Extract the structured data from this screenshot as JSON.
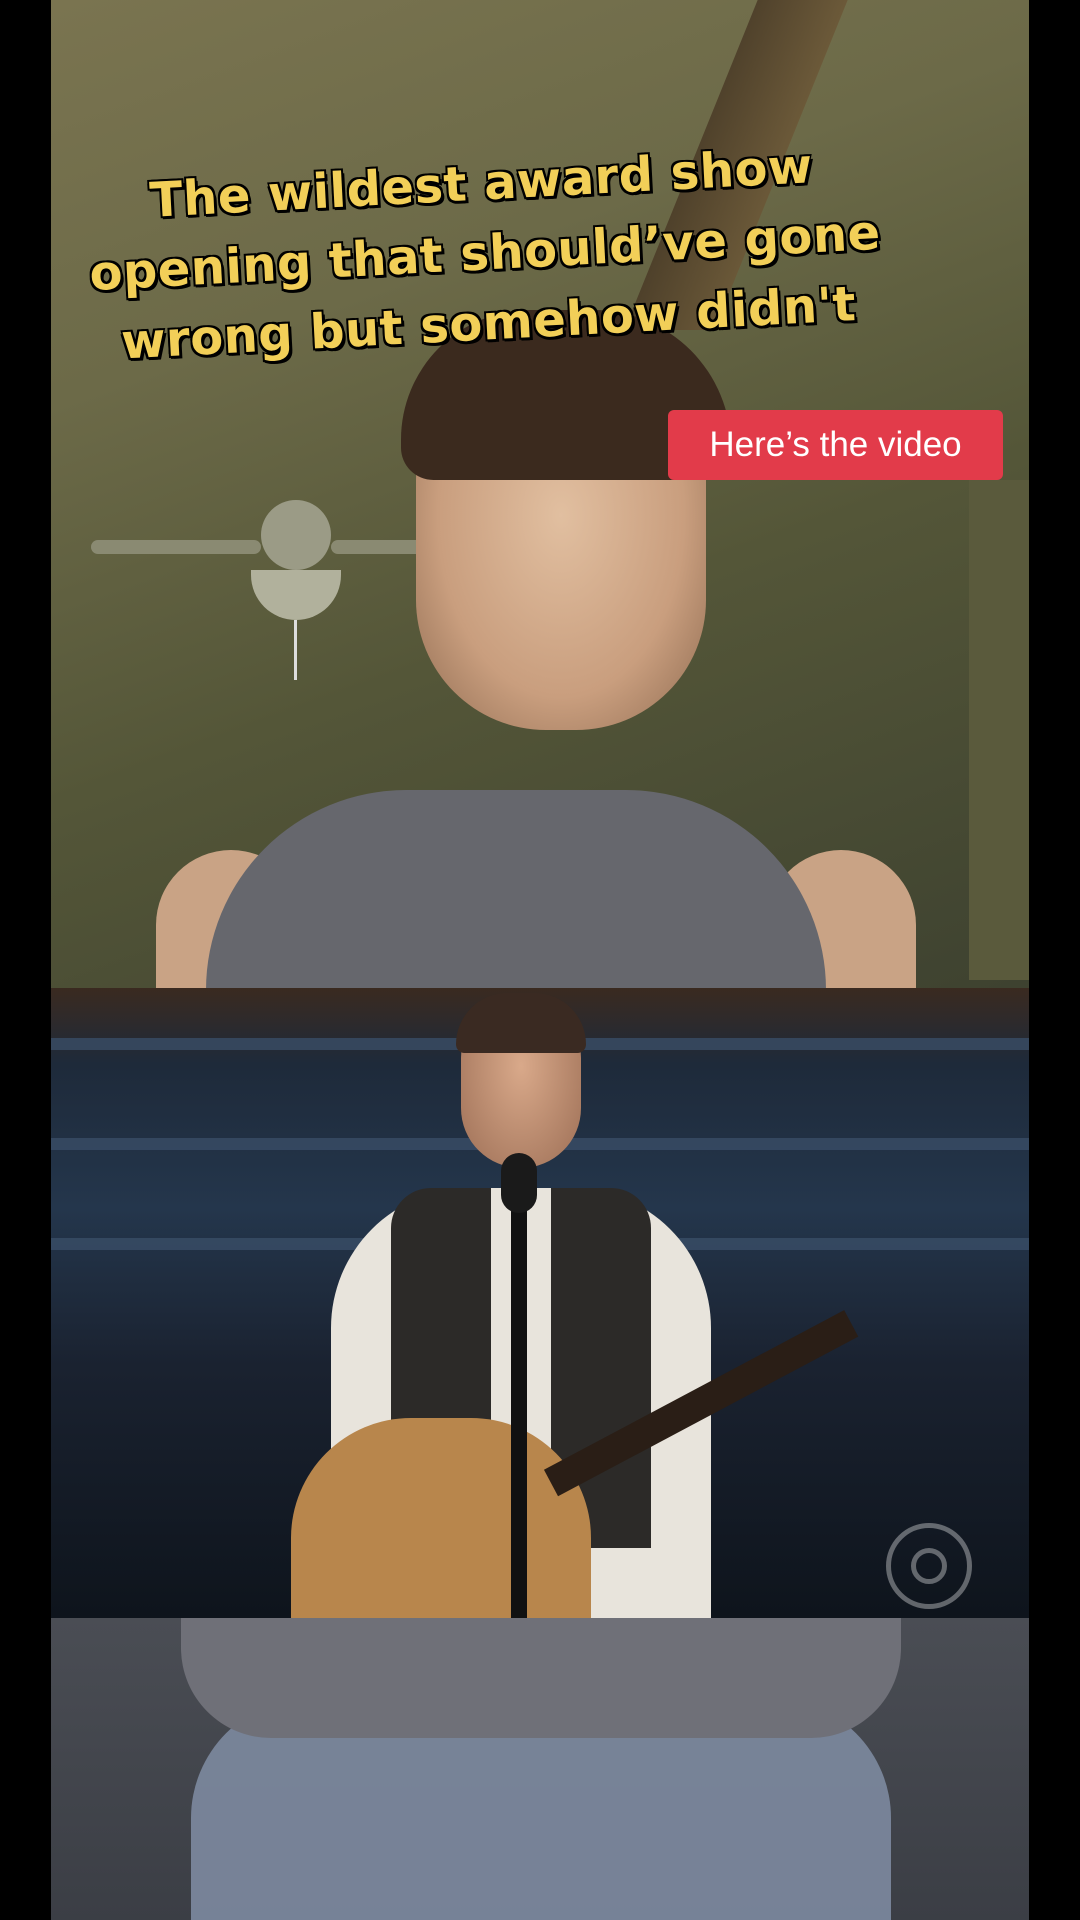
{
  "caption": {
    "lines": [
      "The wildest award show",
      "opening that should’ve gone",
      "wrong but somehow didn't"
    ]
  },
  "link_badge": {
    "label": "Here’s the video",
    "color": "#e23b4a"
  },
  "colors": {
    "caption_text": "#f2cf58",
    "background": "#000000"
  },
  "icons": {
    "network_logo": "cbs-eye-logo"
  }
}
